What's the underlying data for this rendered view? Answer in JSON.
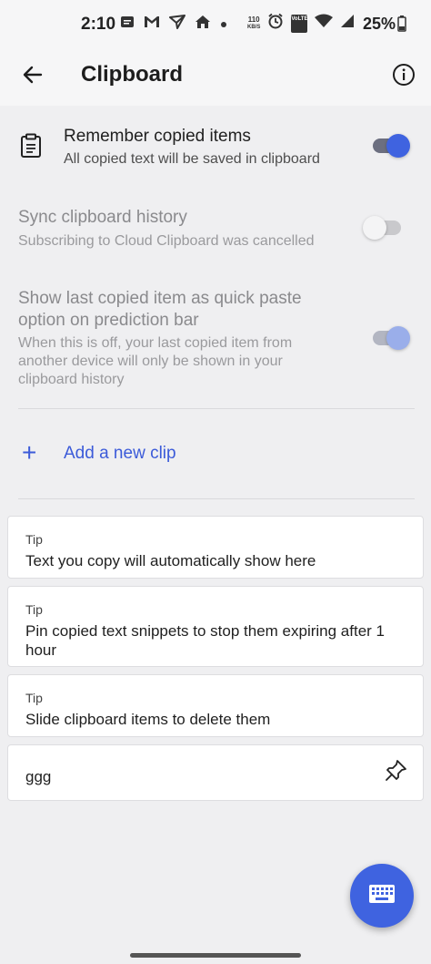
{
  "status_bar": {
    "time": "2:10",
    "net_speed_value": "110",
    "net_speed_unit": "KB/S",
    "volte_label": "VoLTE",
    "battery_percent": "25%"
  },
  "app_bar": {
    "title": "Clipboard"
  },
  "settings": {
    "remember": {
      "title": "Remember copied items",
      "subtitle": "All copied text will be saved in clipboard",
      "enabled": true
    },
    "sync": {
      "title": "Sync clipboard history",
      "subtitle": "Subscribing to Cloud Clipboard was cancelled",
      "enabled": false
    },
    "quick_paste": {
      "title_line1": "Show last copied item as quick paste",
      "title_line2": "option on prediction bar",
      "subtitle_line1": "When this is off, your last copied item from",
      "subtitle_line2": "another device will only be shown in your",
      "subtitle_line3": "clipboard history",
      "enabled": true
    }
  },
  "add_clip": {
    "plus": "+",
    "label": "Add a new clip"
  },
  "cards": {
    "tip1": {
      "label": "Tip",
      "text": "Text you copy will automatically show here"
    },
    "tip2": {
      "label": "Tip",
      "text_line1": "Pin copied text snippets to stop them expiring after 1",
      "text_line2": "hour"
    },
    "tip3": {
      "label": "Tip",
      "text": "Slide clipboard items to delete them"
    },
    "clip1": {
      "text": "ggg"
    }
  },
  "colors": {
    "accent": "#3c5bd9",
    "toggle_on_thumb": "#3f63e0",
    "toggle_disabled_thumb": "#9aaeea",
    "background": "#efeff1"
  },
  "icons": {
    "back": "arrow-left-icon",
    "info": "info-circle-icon",
    "clipboard": "clipboard-icon",
    "pin": "pin-icon",
    "keyboard": "keyboard-icon"
  }
}
